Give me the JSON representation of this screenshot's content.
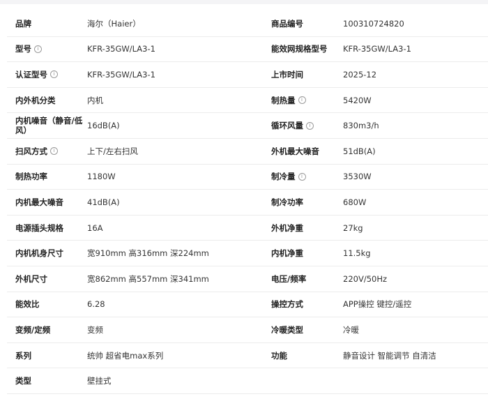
{
  "specs": [
    [
      {
        "label": "品牌",
        "value": "海尔（Haier）",
        "info": false
      },
      {
        "label": "商品编号",
        "value": "100310724820",
        "info": false
      }
    ],
    [
      {
        "label": "型号",
        "value": "KFR-35GW/LA3-1",
        "info": true
      },
      {
        "label": "能效网规格型号",
        "value": "KFR-35GW/LA3-1",
        "info": false
      }
    ],
    [
      {
        "label": "认证型号",
        "value": "KFR-35GW/LA3-1",
        "info": true
      },
      {
        "label": "上市时间",
        "value": "2025-12",
        "info": false
      }
    ],
    [
      {
        "label": "内外机分类",
        "value": "内机",
        "info": false
      },
      {
        "label": "制热量",
        "value": "5420W",
        "info": true
      }
    ],
    [
      {
        "label": "内机噪音（静音/低风）",
        "value": "16dB(A)",
        "info": false
      },
      {
        "label": "循环风量",
        "value": "830m3/h",
        "info": true
      }
    ],
    [
      {
        "label": "扫风方式",
        "value": "上下/左右扫风",
        "info": true
      },
      {
        "label": "外机最大噪音",
        "value": "51dB(A)",
        "info": false
      }
    ],
    [
      {
        "label": "制热功率",
        "value": "1180W",
        "info": false
      },
      {
        "label": "制冷量",
        "value": "3530W",
        "info": true
      }
    ],
    [
      {
        "label": "内机最大噪音",
        "value": "41dB(A)",
        "info": false
      },
      {
        "label": "制冷功率",
        "value": "680W",
        "info": false
      }
    ],
    [
      {
        "label": "电源插头规格",
        "value": "16A",
        "info": false
      },
      {
        "label": "外机净重",
        "value": "27kg",
        "info": false
      }
    ],
    [
      {
        "label": "内机机身尺寸",
        "value": "宽910mm 高316mm 深224mm",
        "info": false
      },
      {
        "label": "内机净重",
        "value": "11.5kg",
        "info": false
      }
    ],
    [
      {
        "label": "外机尺寸",
        "value": "宽862mm 高557mm 深341mm",
        "info": false
      },
      {
        "label": "电压/频率",
        "value": "220V/50Hz",
        "info": false
      }
    ],
    [
      {
        "label": "能效比",
        "value": "6.28",
        "info": false
      },
      {
        "label": "操控方式",
        "value": "APP操控 键控/遥控",
        "info": false
      }
    ],
    [
      {
        "label": "变频/定频",
        "value": "变频",
        "info": false
      },
      {
        "label": "冷暖类型",
        "value": "冷暖",
        "info": false
      }
    ],
    [
      {
        "label": "系列",
        "value": "统帅 超省电max系列",
        "info": false
      },
      {
        "label": "功能",
        "value": "静音设计 智能调节 自清洁",
        "info": false
      }
    ],
    [
      {
        "label": "类型",
        "value": "壁挂式",
        "info": false
      },
      null
    ]
  ]
}
